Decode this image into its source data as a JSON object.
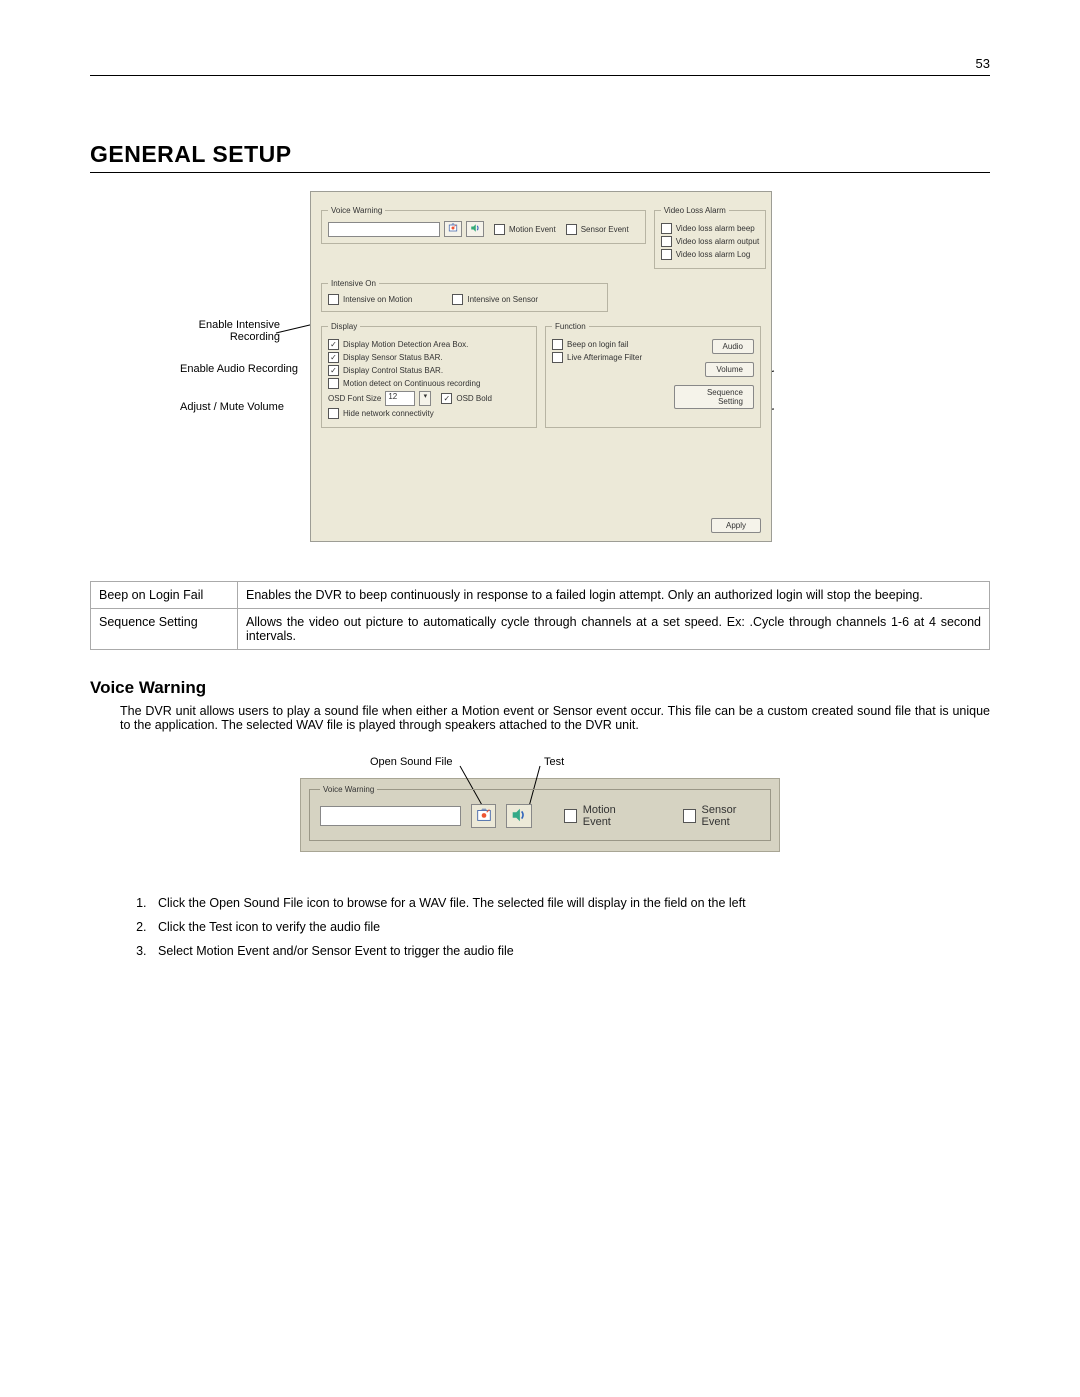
{
  "pageNumber": "53",
  "title": "GENERAL SETUP",
  "dialog": {
    "voiceWarning": {
      "legend": "Voice Warning",
      "path": "",
      "motion": "Motion Event",
      "sensor": "Sensor Event"
    },
    "videoLoss": {
      "legend": "Video Loss Alarm",
      "beep": "Video loss alarm beep",
      "output": "Video loss alarm output",
      "log": "Video loss alarm Log"
    },
    "intensive": {
      "legend": "Intensive On",
      "motion": "Intensive on Motion",
      "sensor": "Intensive on Sensor"
    },
    "display": {
      "legend": "Display",
      "motionBox": "Display Motion Detection Area Box.",
      "sensorBar": "Display Sensor Status BAR.",
      "controlBar": "Display Control Status BAR.",
      "motionCont": "Motion detect on Continuous recording",
      "fontLabel": "OSD Font Size",
      "fontValue": "12",
      "osdBold": "OSD Bold",
      "hideNet": "Hide network connectivity"
    },
    "func": {
      "legend": "Function",
      "beepLogin": "Beep on login fail",
      "liveFilter": "Live Afterimage Filter",
      "audio": "Audio",
      "volume": "Volume",
      "seq": "Sequence Setting"
    },
    "apply": "Apply"
  },
  "callouts1": {
    "intensive": "Enable Intensive Recording",
    "audio": "Enable Audio Recording",
    "volume": "Adjust / Mute Volume"
  },
  "descTable": [
    {
      "label": "Beep on Login Fail",
      "text": "Enables the DVR to beep continuously in response to a failed login attempt.  Only an authorized login will stop the beeping."
    },
    {
      "label": "Sequence Setting",
      "text": "Allows the video out picture to automatically cycle through channels at a set speed.  Ex: .Cycle through channels 1-6 at 4 second intervals."
    }
  ],
  "voiceWarningHeading": "Voice Warning",
  "voiceWarningBody": "The DVR unit allows users to play a sound file when either a Motion event or Sensor event occur. This file can be a custom created sound file that is unique to the application. The selected WAV file is played through speakers attached to the DVR unit.",
  "callouts2": {
    "open": "Open Sound File",
    "test": "Test"
  },
  "vw2": {
    "legend": "Voice Warning",
    "motion": "Motion Event",
    "sensor": "Sensor Event"
  },
  "steps": [
    "Click the Open Sound File icon to browse for a WAV file.  The selected file will display in the field on the left",
    "Click the Test icon to verify the audio file",
    "Select Motion Event and/or Sensor Event to trigger the audio file"
  ]
}
